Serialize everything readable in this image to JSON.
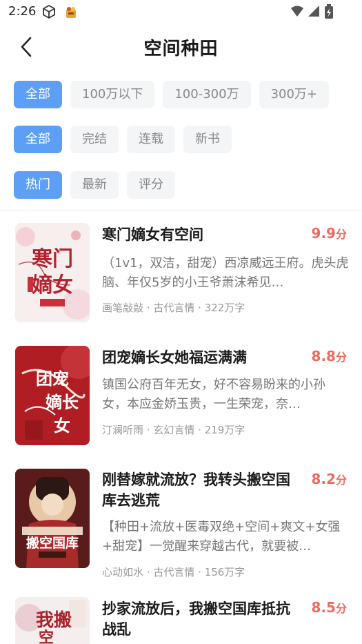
{
  "status_bar": {
    "time": "2:26",
    "icons": [
      "cube-icon",
      "app-notification-icon",
      "wifi-icon",
      "signal-icon",
      "battery-icon"
    ]
  },
  "header": {
    "title": "空间种田",
    "back_icon": "chevron-left-icon"
  },
  "filters": {
    "word_count": {
      "options": [
        "全部",
        "100万以下",
        "100-300万",
        "300万+"
      ],
      "selected": "全部"
    },
    "status": {
      "options": [
        "全部",
        "完结",
        "连载",
        "新书"
      ],
      "selected": "全部"
    },
    "sort": {
      "options": [
        "热门",
        "最新",
        "评分"
      ],
      "selected": "热门"
    }
  },
  "colors": {
    "accent": "#5c9ff5",
    "score": "#ee6a5e",
    "chip_bg": "#f4f5f7"
  },
  "books": [
    {
      "title": "寒门嫡女有空间",
      "score": "9.9",
      "score_unit": "分",
      "description": "（1v1，双洁，甜宠）西凉威远王府。虎头虎脑、年仅5岁的小王爷萧沫希见…",
      "author": "画笔敲敲",
      "genre": "古代言情",
      "words": "322万字",
      "cover_text": "寒门嫡女"
    },
    {
      "title": "团宠嫡长女她福运满满",
      "score": "8.8",
      "score_unit": "分",
      "description": "镇国公府百年无女，好不容易盼来的小孙女，本应金娇玉贵，一生荣宠，奈…",
      "author": "汀澜听雨",
      "genre": "玄幻言情",
      "words": "219万字",
      "cover_text": "团宠嫡长女"
    },
    {
      "title": "刚替嫁就流放？我转头搬空国库去逃荒",
      "score": "8.2",
      "score_unit": "分",
      "description": "【种田+流放+医毒双绝+空间+爽文+女强+甜宠】一觉醒来穿越古代，就要被…",
      "author": "心动如水",
      "genre": "古代言情",
      "words": "156万字",
      "cover_text": "搬空国库"
    },
    {
      "title": "抄家流放后，我搬空国库抵抗战乱",
      "score": "8.5",
      "score_unit": "分",
      "cover_text": "我搬空"
    }
  ]
}
